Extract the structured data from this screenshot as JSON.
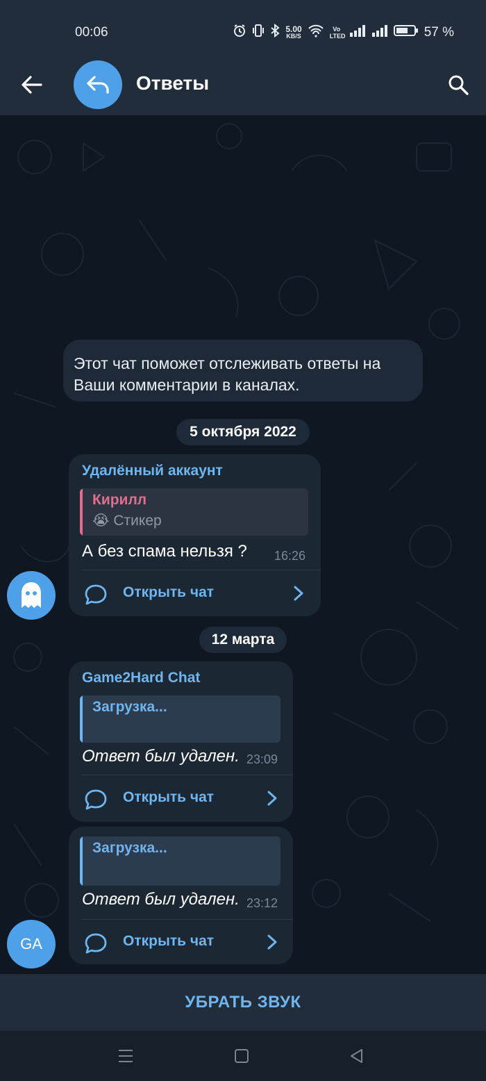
{
  "status_bar": {
    "time": "00:06",
    "net_speed_value": "5.00",
    "net_speed_unit": "KB/S",
    "volte": "Vo LTED",
    "battery": "57 %"
  },
  "header": {
    "title": "Ответы"
  },
  "service_message": "Этот чат поможет отслеживать ответы на Ваши комментарии в каналах.",
  "groups": [
    {
      "date": "5 октября 2022",
      "messages": [
        {
          "sender": "Удалённый аккаунт",
          "reply_name": "Кирилл",
          "reply_emoji": "😭",
          "reply_text": "Стикер",
          "text": "А без спама нельзя ?",
          "time": "16:26",
          "action": "Открыть чат",
          "avatar_icon": "ghost-icon"
        }
      ]
    },
    {
      "date": "12 марта",
      "messages": [
        {
          "sender": "Game2Hard Chat",
          "reply_name": "Загрузка...",
          "text": "Ответ был удален.",
          "time": "23:09",
          "action": "Открыть чат"
        },
        {
          "reply_name": "Загрузка...",
          "text": "Ответ был удален.",
          "time": "23:12",
          "action": "Открыть чат",
          "avatar_initials": "GA"
        }
      ]
    }
  ],
  "mute_button": "УБРАТЬ ЗВУК",
  "colors": {
    "accent": "#6fb5ef",
    "avatar_blue": "#4ea1e8",
    "reply_pink": "#e56b8f",
    "header_bg": "#212d3b",
    "chat_bg": "#0f1822"
  }
}
